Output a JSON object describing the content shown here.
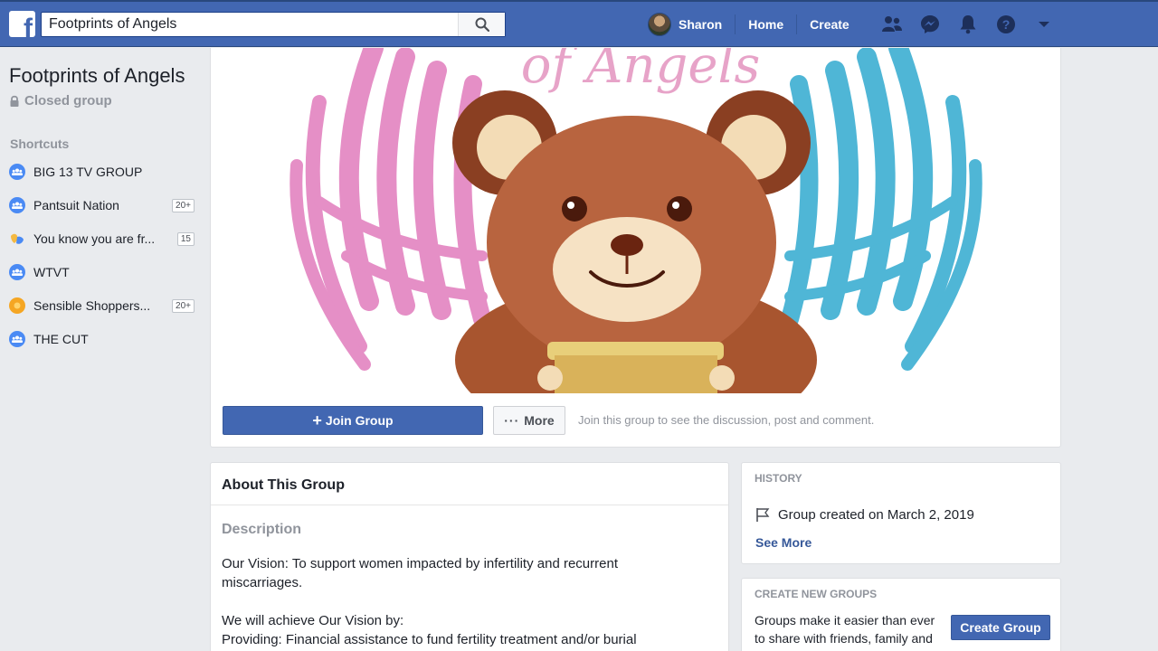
{
  "search": {
    "value": "Footprints of Angels"
  },
  "nav": {
    "user_name": "Sharon",
    "home_label": "Home",
    "create_label": "Create"
  },
  "group": {
    "title": "Footprints of Angels",
    "privacy": "Closed group",
    "cover_text": "of Angels"
  },
  "sidebar": {
    "shortcuts_heading": "Shortcuts",
    "items": [
      {
        "label": "BIG 13 TV GROUP",
        "count": "",
        "icon": "group-icon"
      },
      {
        "label": "Pantsuit Nation",
        "count": "20+",
        "icon": "group-icon"
      },
      {
        "label": "You know you are fr...",
        "count": "15",
        "icon": "hand-icon"
      },
      {
        "label": "WTVT",
        "count": "",
        "icon": "group-icon"
      },
      {
        "label": "Sensible Shoppers...",
        "count": "20+",
        "icon": "shopper-icon"
      },
      {
        "label": "THE CUT",
        "count": "",
        "icon": "group-icon"
      }
    ]
  },
  "actions": {
    "join_label": "Join Group",
    "more_label": "More",
    "join_hint": "Join this group to see the discussion, post and comment."
  },
  "about": {
    "heading": "About This Group",
    "description_heading": "Description",
    "para1": "Our Vision: To support women impacted by infertility and recurrent miscarriages.",
    "para2_line1": "We will achieve Our Vision by:",
    "para2_line2": "Providing: Financial assistance to fund fertility treatment and/or burial"
  },
  "history": {
    "heading": "HISTORY",
    "created": "Group created on March 2, 2019",
    "see_more": "See More"
  },
  "create_groups": {
    "heading": "CREATE NEW GROUPS",
    "text": "Groups make it easier than ever to share with friends, family and teammates.",
    "button": "Create Group"
  },
  "colors": {
    "brand": "#4267b2",
    "wing_pink": "#e58fc6",
    "wing_blue": "#4fb6d6",
    "bear": "#b8643f"
  }
}
